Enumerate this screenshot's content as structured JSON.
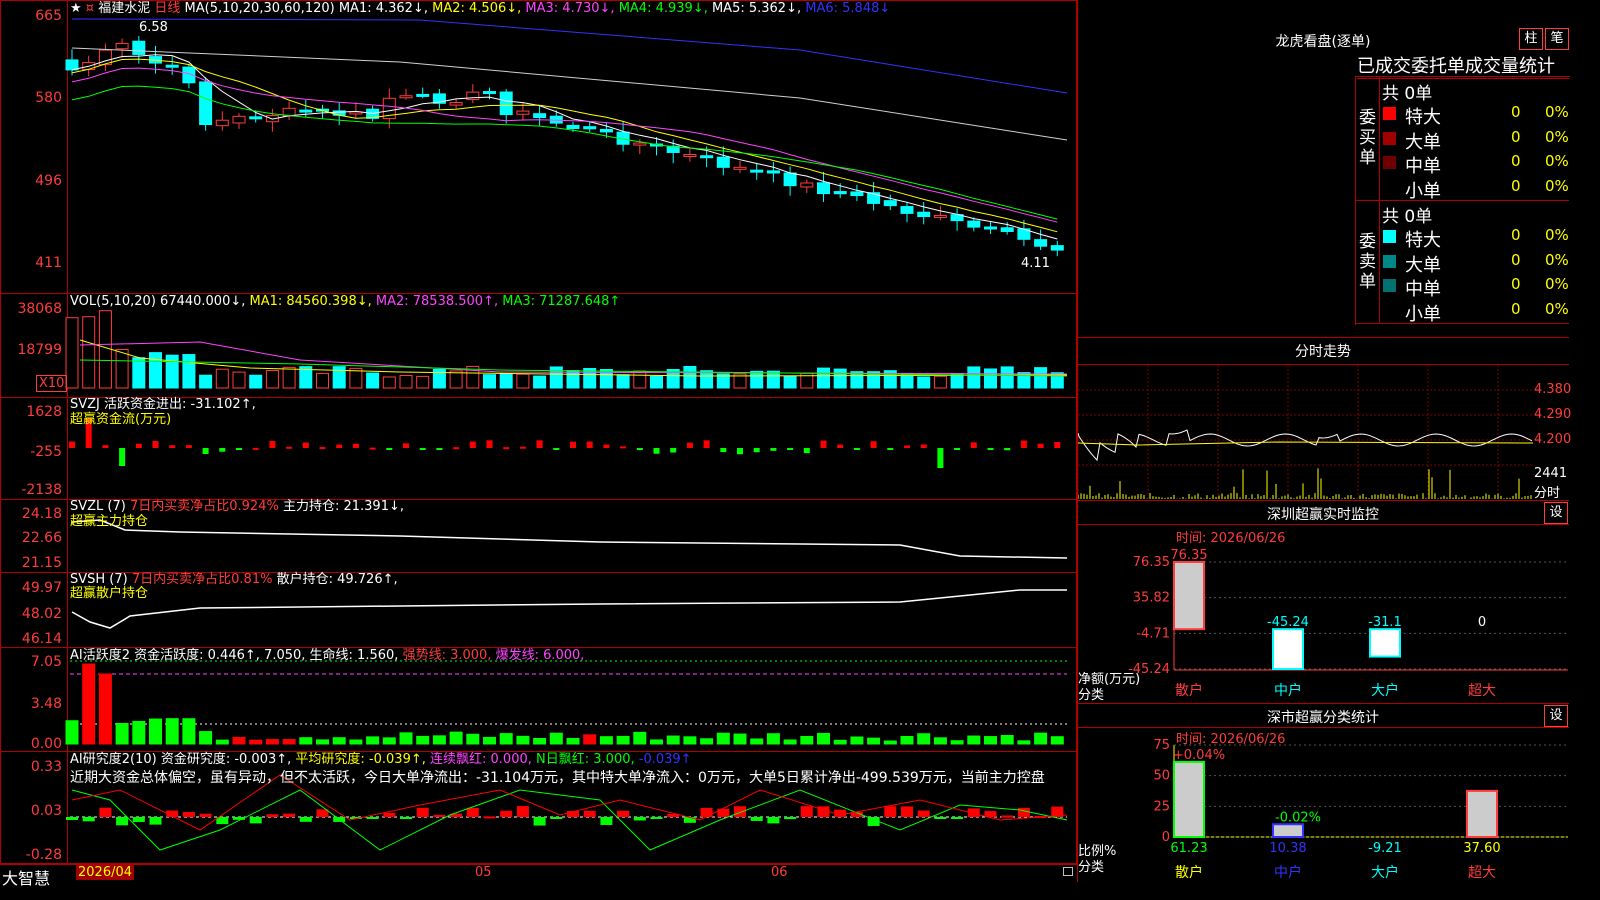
{
  "app": {
    "name": "大智慧"
  },
  "left_axis": {
    "price": [
      "665",
      "580",
      "496",
      "411"
    ],
    "vol": [
      "38068",
      "18799",
      "X10"
    ],
    "svzj": [
      "1628",
      "-255",
      "-2138"
    ],
    "svzl": [
      "24.18",
      "22.66",
      "21.15"
    ],
    "svsh": [
      "49.97",
      "48.02",
      "46.14"
    ],
    "ai": [
      "7.05",
      "3.48",
      "0.00"
    ],
    "research": [
      "0.33",
      "0.03",
      "-0.28"
    ]
  },
  "main_chart": {
    "star_icon": "★",
    "stock_name": "福建水泥",
    "period": "日线",
    "ma_params": "MA(5,10,20,30,60,120)",
    "ma1": "MA1: 4.362↓,",
    "ma2": "MA2: 4.506↓,",
    "ma3": "MA3: 4.730↓,",
    "ma4": "MA4: 4.939↓,",
    "ma5": "MA5: 5.362↓,",
    "ma6": "MA6: 5.848↓",
    "high_label": "6.58",
    "low_label": "4.11",
    "colors": {
      "up": "#ff3c3c",
      "down": "#00ffff",
      "ma1": "#ffffff",
      "ma2": "#ffff00",
      "ma3": "#ff44ff",
      "ma4": "#00ff00",
      "ma5": "#d0d0d0",
      "ma6": "#3333ff"
    }
  },
  "vol_panel": {
    "params": "VOL(5,10,20)",
    "value": "67440.000↓,",
    "ma1": "MA1: 84560.398↓,",
    "ma2": "MA2: 78538.500↑,",
    "ma3": "MA3: 71287.648↑"
  },
  "svzj_panel": {
    "header": "SVZJ  活跃资金进出: -31.102↑,",
    "sub": "超赢资金流(万元)"
  },
  "svzl_panel": {
    "name": "SVZL (7)",
    "metric": "7日内买卖净占比0.924%",
    "value": "主力持仓: 21.391↓,",
    "sub": "超赢主力持仓"
  },
  "svsh_panel": {
    "name": "SVSH (7)",
    "metric": "7日内买卖净占比0.81%",
    "value": "散户持仓: 49.726↑,",
    "sub": "超赢散户持仓"
  },
  "ai_panel": {
    "name": "AI活跃度2",
    "v1": "资金活跃度: 0.446↑,",
    "v2": "7.050,",
    "v3": "生命线: 1.560,",
    "v4": "强势线: 3.000,",
    "v5": "爆发线: 6.000,"
  },
  "research_panel": {
    "name": "AI研究度2(10)",
    "v1": "资金研究度: -0.003↑,",
    "v2": "平均研究度: -0.039↑,",
    "v3": "连续飘红: 0.000,",
    "v4": "N日飘红: 3.000,",
    "v5": "-0.039↑",
    "comment": "近期大资金总体偏空，虽有异动，但不太活跃，今日大单净流出：-31.104万元，其中特大单净流入：0万元，大单5日累计净出-499.539万元，当前主力控盘"
  },
  "time_axis": {
    "t1": "2026/04",
    "t2": "05",
    "t3": "06"
  },
  "dragon": {
    "title": "龙虎看盘(逐单)",
    "btn1": "柱",
    "btn2": "笔",
    "tabs": "已成交委托单成交量统计",
    "buy_side": "委买单",
    "sell_side": "委卖单",
    "buy_total": "共 0单",
    "sell_total": "共 0单",
    "buy_rows": [
      {
        "label": "特大",
        "count": "0",
        "pct": "0%",
        "color": "#ff0000"
      },
      {
        "label": "大单",
        "count": "0",
        "pct": "0%",
        "color": "#a00000"
      },
      {
        "label": "中单",
        "count": "0",
        "pct": "0%",
        "color": "#700000"
      },
      {
        "label": "小单",
        "count": "0",
        "pct": "0%",
        "color": ""
      }
    ],
    "sell_rows": [
      {
        "label": "特大",
        "count": "0",
        "pct": "0%",
        "color": "#00ffff"
      },
      {
        "label": "大单",
        "count": "0",
        "pct": "0%",
        "color": "#008888"
      },
      {
        "label": "中单",
        "count": "0",
        "pct": "0%",
        "color": "#007070"
      },
      {
        "label": "小单",
        "count": "0",
        "pct": "0%",
        "color": ""
      }
    ]
  },
  "intraday": {
    "title": "分时走势",
    "p1": "4.380",
    "p2": "4.290",
    "p3": "4.200",
    "vol": "2441",
    "unit": "分时"
  },
  "monitor": {
    "title": "深圳超赢实时监控",
    "btn": "设",
    "time": "时间: 2026/06/26",
    "yticks": [
      "76.35",
      "35.82",
      "-4.71",
      "-45.24"
    ],
    "ylabel": "净额(万元)",
    "xlabel": "分类",
    "categories": [
      "散户",
      "中户",
      "大户",
      "超大"
    ],
    "bar_values": [
      "76.35",
      "-45.24",
      "-31.1",
      "0"
    ]
  },
  "classify": {
    "title": "深市超赢分类统计",
    "btn": "设",
    "time": "时间: 2026/06/26",
    "yticks": [
      "75",
      "50",
      "25",
      "0"
    ],
    "ylabel": "比例%",
    "xlabel": "分类",
    "categories": [
      "散户",
      "中户",
      "大户",
      "超大"
    ],
    "top_labels": [
      "+0.04%",
      "-0.02%"
    ],
    "bottom_values": [
      "61.23",
      "10.38",
      "-9.21",
      "37.60"
    ]
  },
  "chart_data": {
    "type": "table",
    "monitor_bars": {
      "categories": [
        "散户",
        "中户",
        "大户",
        "超大"
      ],
      "values": [
        76.35,
        -45.24,
        -31.1,
        0
      ],
      "ylim": [
        -45.24,
        76.35
      ]
    },
    "classify_bars": {
      "categories": [
        "散户",
        "中户",
        "大户",
        "超大"
      ],
      "values": [
        61.23,
        10.38,
        -9.21,
        37.6
      ],
      "ylim": [
        0,
        75
      ]
    }
  }
}
